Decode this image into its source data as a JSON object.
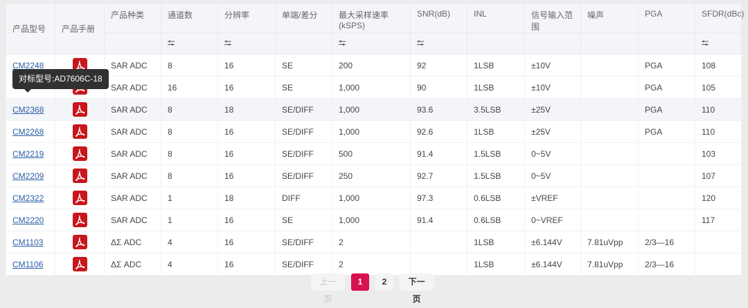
{
  "headers": [
    "产品型号",
    "产品手册",
    "产品种类",
    "通道数",
    "分辨率",
    "单端/差分",
    "最大采样速率(kSPS)",
    "SNR(dB)",
    "INL",
    "信号输入范围",
    "噪声",
    "PGA",
    "SFDR(dBc)"
  ],
  "filter_cols": [
    3,
    4,
    6,
    7,
    12
  ],
  "rows": [
    [
      "CM2248",
      "",
      "SAR ADC",
      "8",
      "16",
      "SE",
      "200",
      "92",
      "1LSB",
      "±10V",
      "",
      "PGA",
      "108"
    ],
    [
      "",
      "",
      "SAR ADC",
      "16",
      "16",
      "SE",
      "1,000",
      "90",
      "1LSB",
      "±10V",
      "",
      "PGA",
      "105"
    ],
    [
      "CM2368",
      "",
      "SAR ADC",
      "8",
      "18",
      "SE/DIFF",
      "1,000",
      "93.6",
      "3.5LSB",
      "±25V",
      "",
      "PGA",
      "110"
    ],
    [
      "CM2268",
      "",
      "SAR ADC",
      "8",
      "16",
      "SE/DIFF",
      "1,000",
      "92.6",
      "1LSB",
      "±25V",
      "",
      "PGA",
      "110"
    ],
    [
      "CM2219",
      "",
      "SAR ADC",
      "8",
      "16",
      "SE/DIFF",
      "500",
      "91.4",
      "1.5LSB",
      "0~5V",
      "",
      "",
      "103"
    ],
    [
      "CM2209",
      "",
      "SAR ADC",
      "8",
      "16",
      "SE/DIFF",
      "250",
      "92.7",
      "1.5LSB",
      "0~5V",
      "",
      "",
      "107"
    ],
    [
      "CM2322",
      "",
      "SAR ADC",
      "1",
      "18",
      "DIFF",
      "1,000",
      "97.3",
      "0.6LSB",
      "±VREF",
      "",
      "",
      "120"
    ],
    [
      "CM2220",
      "",
      "SAR ADC",
      "1",
      "16",
      "SE",
      "1,000",
      "91.4",
      "0.6LSB",
      "0~VREF",
      "",
      "",
      "117"
    ],
    [
      "CM1103",
      "",
      "ΔΣ ADC",
      "4",
      "16",
      "SE/DIFF",
      "2",
      "",
      "1LSB",
      "±6.144V",
      "7.81uVpp",
      "2/3—16",
      ""
    ],
    [
      "CM1106",
      "",
      "ΔΣ ADC",
      "4",
      "16",
      "SE/DIFF",
      "2",
      "",
      "1LSB",
      "±6.144V",
      "7.81uVpp",
      "2/3—16",
      ""
    ]
  ],
  "tooltip": "对标型号:AD7606C-18",
  "pagination": {
    "prev": "上一页",
    "pages": [
      "1",
      "2"
    ],
    "current": "1",
    "next": "下一页"
  },
  "colors": {
    "accent": "#d8124f",
    "pdf": "#c8161d",
    "link": "#2a5ea8"
  }
}
